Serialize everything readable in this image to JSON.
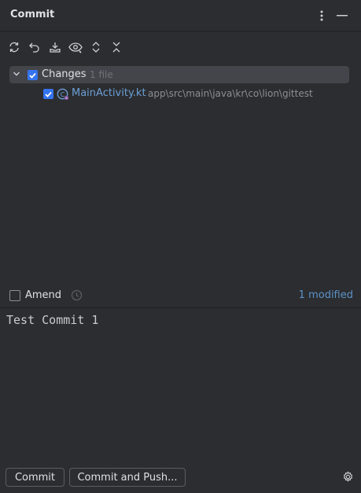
{
  "panel": {
    "title": "Commit",
    "more_icon": "vertical-ellipsis-icon",
    "minimize_icon": "minimize-icon"
  },
  "toolbar": {
    "buttons": [
      {
        "name": "refresh",
        "icon": "refresh-icon"
      },
      {
        "name": "rollback",
        "icon": "undo-icon"
      },
      {
        "name": "shelve",
        "icon": "download-tray-icon"
      },
      {
        "name": "show-diff",
        "icon": "eye-icon"
      },
      {
        "name": "expand-all",
        "icon": "expand-icon"
      },
      {
        "name": "collapse-all",
        "icon": "collapse-icon"
      }
    ]
  },
  "changes": {
    "label": "Changes",
    "count": "1 file",
    "checked": true,
    "files": [
      {
        "name": "MainActivity.kt",
        "path": "app\\src\\main\\java\\kr\\co\\lion\\gittest",
        "checked": true
      }
    ]
  },
  "amend": {
    "label": "Amend",
    "checked": false,
    "modified_label": "1 modified"
  },
  "message": {
    "text": "Test Commit 1"
  },
  "actions": {
    "commit_label": "Commit",
    "commit_push_label": "Commit and Push..."
  },
  "colors": {
    "background": "#2b2d30",
    "accent": "#3574f0",
    "file_link": "#6d9fd8",
    "modified": "#5c92c7"
  }
}
